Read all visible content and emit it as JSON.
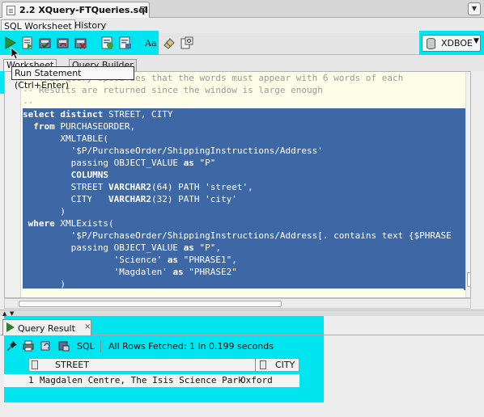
{
  "document_tab": {
    "title": "2.2 XQuery-FTQueries.sql",
    "close": "⊠"
  },
  "sub_tabs": {
    "worksheet": "SQL Worksheet",
    "history": "History"
  },
  "toolbar": {
    "run_tooltip": "Run Statement (Ctrl+Enter)",
    "connection": "XDBOE"
  },
  "editor_tabs": {
    "worksheet": "Worksheet",
    "query_builder": "Query Builder"
  },
  "code_lines": [
    {
      "text": "-- This query specifies that the words must appear with 6 words of each",
      "style": "comment"
    },
    {
      "text": "-- Results are returned since the window is large enough",
      "style": "comment"
    },
    {
      "text": "--",
      "style": "comment"
    },
    {
      "text": "select distinct STREET, CITY",
      "style": "sel"
    },
    {
      "text": "  from PURCHASEORDER,",
      "style": "sel"
    },
    {
      "text": "       XMLTABLE(",
      "style": "sel"
    },
    {
      "text": "         '$P/PurchaseOrder/ShippingInstructions/Address'",
      "style": "sel"
    },
    {
      "text": "         passing OBJECT_VALUE as \"P\"",
      "style": "sel"
    },
    {
      "text": "         COLUMNS",
      "style": "sel"
    },
    {
      "text": "         STREET VARCHAR2(64) PATH 'street',",
      "style": "sel"
    },
    {
      "text": "         CITY   VARCHAR2(32) PATH 'city'",
      "style": "sel"
    },
    {
      "text": "       )",
      "style": "sel"
    },
    {
      "text": " where XMLExists(",
      "style": "sel"
    },
    {
      "text": "         '$P/PurchaseOrder/ShippingInstructions/Address[. contains text {$PHRASE",
      "style": "sel"
    },
    {
      "text": "         passing OBJECT_VALUE as \"P\",",
      "style": "sel"
    },
    {
      "text": "                 'Science' as \"PHRASE1\",",
      "style": "sel"
    },
    {
      "text": "                 'Magdalen' as \"PHRASE2\"",
      "style": "sel"
    },
    {
      "text": "       )",
      "style": "sel"
    }
  ],
  "result_tab": {
    "label": "Query Result",
    "close": "×"
  },
  "result_toolbar": {
    "sql_label": "SQL",
    "status": "All Rows Fetched: 1 in 0.199 seconds"
  },
  "grid": {
    "columns": [
      "STREET",
      "CITY"
    ],
    "rows": [
      {
        "num": "1",
        "street": "Magdalen Centre, The Isis Science Park",
        "city": "Oxford"
      }
    ]
  }
}
